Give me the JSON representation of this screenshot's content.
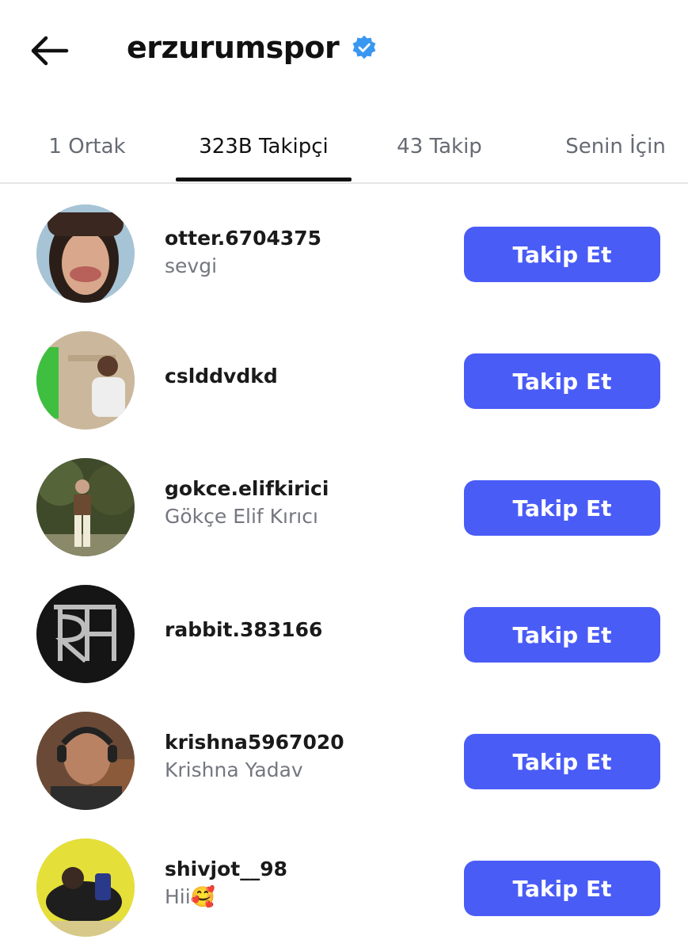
{
  "header": {
    "title": "erzurumspor",
    "back_icon": "arrow-left-icon",
    "verified_icon": "verified-badge-icon",
    "verified_color": "#3897f0"
  },
  "tabs": [
    {
      "label": "1 Ortak"
    },
    {
      "label": "323B Takipçi"
    },
    {
      "label": "43 Takip"
    },
    {
      "label": "Senin İçin"
    }
  ],
  "active_tab": "323B Takipçi",
  "accent_color": "#4a5cf6",
  "followers": [
    {
      "username": "otter.6704375",
      "name": "sevgi",
      "button": "Takip Et"
    },
    {
      "username": "cslddvdkd",
      "name": "",
      "button": "Takip Et"
    },
    {
      "username": "gokce.elifkirici",
      "name": "Gökçe Elif Kırıcı",
      "button": "Takip Et"
    },
    {
      "username": "rabbit.383166",
      "name": "",
      "button": "Takip Et"
    },
    {
      "username": "krishna5967020",
      "name": "Krishna Yadav",
      "button": "Takip Et"
    },
    {
      "username": "shivjot__98",
      "name": "Hii🥰",
      "button": "Takip Et"
    }
  ]
}
